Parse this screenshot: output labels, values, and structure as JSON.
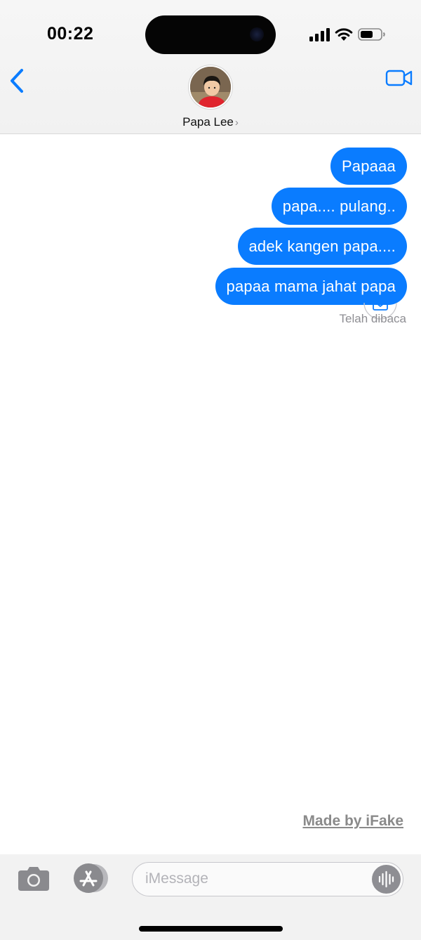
{
  "status_bar": {
    "time": "00:22",
    "icons": [
      "cellular-signal-icon",
      "wifi-icon",
      "battery-icon"
    ]
  },
  "header": {
    "back_icon": "chevron-left-icon",
    "contact_name": "Papa Lee",
    "contact_chevron": "›",
    "video_icon": "video-camera-icon"
  },
  "messages": [
    {
      "text": "Papaaa",
      "sender": "me"
    },
    {
      "text": "papa.... pulang..",
      "sender": "me"
    },
    {
      "text": "adek kangen papa....",
      "sender": "me"
    },
    {
      "text": "papaa mama jahat papa",
      "sender": "me"
    }
  ],
  "read_receipt": "Telah dibaca",
  "watermark": "Made by iFake",
  "composer": {
    "placeholder": "iMessage",
    "value": "",
    "icons": [
      "camera-icon",
      "app-store-icon",
      "audio-waveform-icon"
    ]
  },
  "colors": {
    "accent": "#0a7cff",
    "bubble_text": "#ffffff",
    "secondary_text": "#8e8e93",
    "watermark": "#8a8a8a"
  }
}
